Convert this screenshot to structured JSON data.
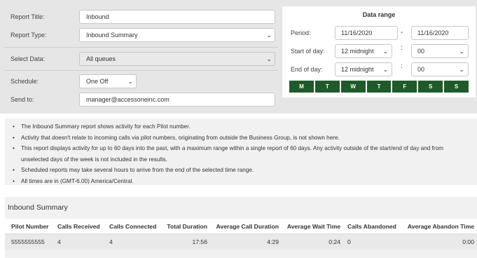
{
  "form": {
    "report_title_label": "Report Title:",
    "report_title_value": "Inbound",
    "report_type_label": "Report Type:",
    "report_type_value": "Inbound Summary",
    "select_data_label": "Select Data:",
    "select_data_value": "All queues",
    "schedule_label": "Schedule:",
    "schedule_value": "One Off",
    "send_to_label": "Send to:",
    "send_to_value": "manager@accessoneinc.com"
  },
  "date_range": {
    "title": "Data range",
    "period_label": "Period:",
    "period_start": "11/16/2020",
    "period_separator": "-",
    "period_end": "11/16/2020",
    "start_label": "Start of day:",
    "start_hour": "12 midnight",
    "start_minute": "00",
    "end_label": "End of day:",
    "end_hour": "12 midnight",
    "end_minute": "00",
    "time_separator": ":",
    "days": [
      "M",
      "T",
      "W",
      "T",
      "F",
      "S",
      "S"
    ]
  },
  "info": [
    "The Inbound Summary report shows activity for each Pilot number.",
    "Activity that doesn't relate to incoming calls via pilot numbers, originating from outside the Business Group, is not shown here.",
    "This report displays activity for up to 60 days into the past, with a maximum range within a single report of 60 days. Any activity outside of the start/end of day and from",
    "unselected days of the week is not included in the results.",
    "Scheduled reports may take several hours to arrive from the end of the selected time range.",
    "All times are in (GMT-6.00) America/Central."
  ],
  "summary": {
    "title": "Inbound Summary",
    "columns": [
      "Pilot Number",
      "Calls Received",
      "Calls Connected",
      "Total Duration",
      "Average Call Duration",
      "Average Wait Time",
      "Calls Abandoned",
      "Average Abandon Time"
    ],
    "rows": [
      [
        "5555555555",
        "4",
        "4",
        "17:56",
        "4:29",
        "0:24",
        "0",
        "0:00"
      ]
    ]
  },
  "icons": {
    "select_chevron": "chevron-down-icon",
    "bullet": "•"
  }
}
